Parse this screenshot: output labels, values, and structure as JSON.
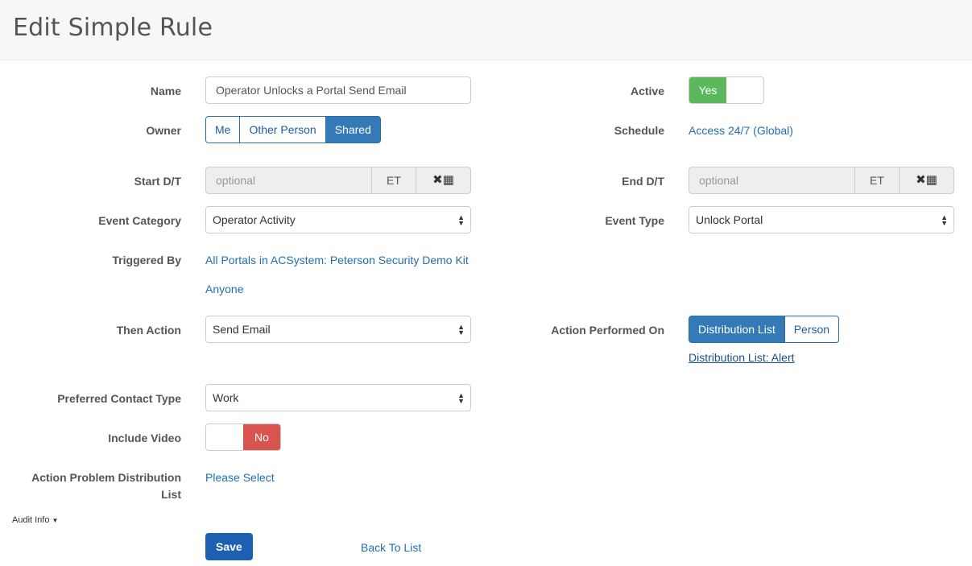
{
  "header": {
    "title": "Edit Simple Rule"
  },
  "fields": {
    "name": {
      "label": "Name",
      "value": "Operator Unlocks a Portal Send Email"
    },
    "active": {
      "label": "Active",
      "value": "Yes"
    },
    "owner": {
      "label": "Owner",
      "options": [
        "Me",
        "Other Person",
        "Shared"
      ],
      "selected": "Shared"
    },
    "schedule": {
      "label": "Schedule",
      "value": "Access 24/7 (Global)"
    },
    "start_dt": {
      "label": "Start D/T",
      "placeholder": "optional",
      "tz": "ET"
    },
    "end_dt": {
      "label": "End D/T",
      "placeholder": "optional",
      "tz": "ET"
    },
    "event_category": {
      "label": "Event Category",
      "value": "Operator Activity"
    },
    "event_type": {
      "label": "Event Type",
      "value": "Unlock Portal"
    },
    "triggered_by": {
      "label": "Triggered By",
      "link1": "All Portals in ACSystem: Peterson Security Demo Kit",
      "link2": "Anyone"
    },
    "then_action": {
      "label": "Then Action",
      "value": "Send Email"
    },
    "action_performed_on": {
      "label": "Action Performed On",
      "options": [
        "Distribution List",
        "Person"
      ],
      "selected": "Distribution List",
      "link": "Distribution List: Alert"
    },
    "preferred_contact_type": {
      "label": "Preferred Contact Type",
      "value": "Work"
    },
    "include_video": {
      "label": "Include Video",
      "value": "No"
    },
    "action_problem_dl": {
      "label_line1": "Action Problem Distribution",
      "label_line2": "List",
      "value": "Please Select"
    }
  },
  "footer": {
    "audit_info": "Audit Info",
    "save": "Save",
    "back": "Back To List"
  },
  "colors": {
    "primary": "#337ab7",
    "success": "#5cb85c",
    "danger": "#d9534f",
    "link": "#1f6fb2"
  },
  "icons": {
    "clear": "times-icon",
    "calendar": "calendar-icon"
  }
}
